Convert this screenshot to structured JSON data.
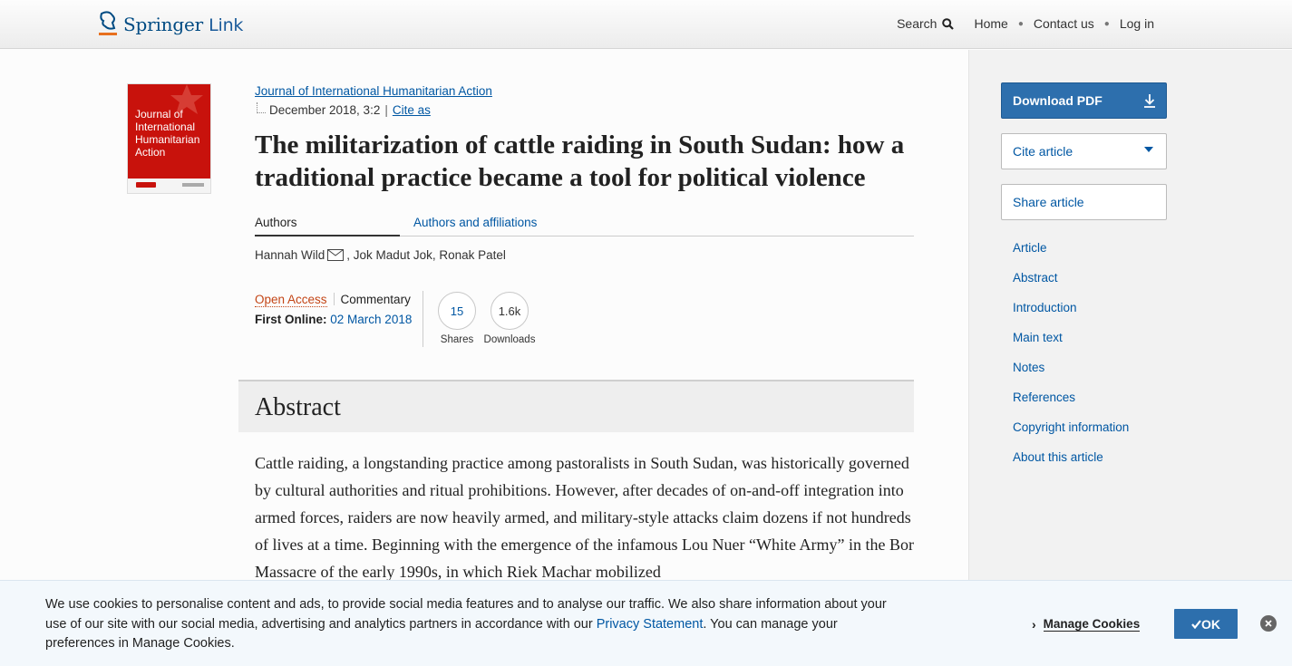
{
  "header": {
    "logo_main": "Springer",
    "logo_sub": "Link",
    "nav": {
      "search": "Search",
      "home": "Home",
      "contact": "Contact us",
      "login": "Log in"
    }
  },
  "cover": {
    "title_lines": [
      "Journal of",
      "International",
      "Humanitarian",
      "Action"
    ]
  },
  "article": {
    "journal": "Journal of International Humanitarian Action",
    "issue": "December 2018, 3:2",
    "cite_as": "Cite as",
    "title": "The militarization of cattle raiding in South Sudan: how a traditional practice became a tool for political violence",
    "tabs": {
      "authors": "Authors",
      "affiliations": "Authors and affiliations"
    },
    "authors": {
      "first": "Hannah Wild",
      "rest": ", Jok Madut Jok, Ronak Patel"
    },
    "open_access": "Open Access",
    "content_type": "Commentary",
    "first_online_label": "First Online:",
    "first_online_date": "02 March 2018",
    "metrics": {
      "shares_value": "15",
      "shares_label": "Shares",
      "downloads_value": "1.6k",
      "downloads_label": "Downloads"
    },
    "abstract_heading": "Abstract",
    "abstract_text": "Cattle raiding, a longstanding practice among pastoralists in South Sudan, was historically governed by cultural authorities and ritual prohibitions. However, after decades of on-and-off integration into armed forces, raiders are now heavily armed, and military-style attacks claim dozens if not hundreds of lives at a time. Beginning with the emergence of the infamous Lou Nuer “White Army” in the Bor Massacre of the early 1990s, in which Riek Machar mobilized"
  },
  "sidebar": {
    "download_pdf": "Download PDF",
    "cite_article": "Cite article",
    "share_article": "Share article",
    "toc": [
      "Article",
      "Abstract",
      "Introduction",
      "Main text",
      "Notes",
      "References",
      "Copyright information",
      "About this article"
    ]
  },
  "cookie": {
    "text_before": "We use cookies to personalise content and ads, to provide social media features and to analyse our traffic. We also share information about your use of our site with our social media, advertising and analytics partners in accordance with our ",
    "privacy_link": "Privacy Statement",
    "text_after": ". You can manage your preferences in Manage Cookies.",
    "manage": "Manage Cookies",
    "ok": "OK",
    "close": "×"
  },
  "colors": {
    "brand_blue": "#2d6fad",
    "link_blue": "#0057a3",
    "open_access_orange": "#c34516",
    "cover_red": "#c8120c"
  }
}
